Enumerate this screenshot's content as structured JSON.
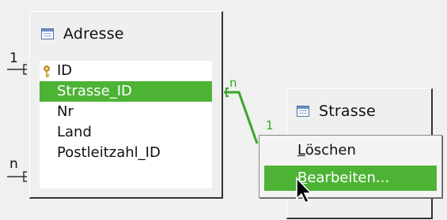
{
  "tables": {
    "adresse": {
      "title": "Adresse",
      "fields": [
        "ID",
        "Strasse_ID",
        "Nr",
        "Land",
        "Postleitzahl_ID"
      ],
      "selected_field": "Strasse_ID",
      "primary_key_field": "ID"
    },
    "strasse": {
      "title": "Strasse"
    }
  },
  "relations": {
    "left_top_label": "1",
    "left_bottom_label": "n",
    "link_start_label": "n",
    "link_end_label": "1"
  },
  "context_menu": {
    "items": [
      {
        "label": "Löschen",
        "mnemonic": "L",
        "rest": "öschen"
      },
      {
        "label": "Bearbeiten...",
        "mnemonic": "B",
        "rest": "earbeiten..."
      }
    ],
    "active_item": "Bearbeiten..."
  },
  "colors": {
    "selection": "#4db335",
    "relation_line": "#3aa52a"
  }
}
